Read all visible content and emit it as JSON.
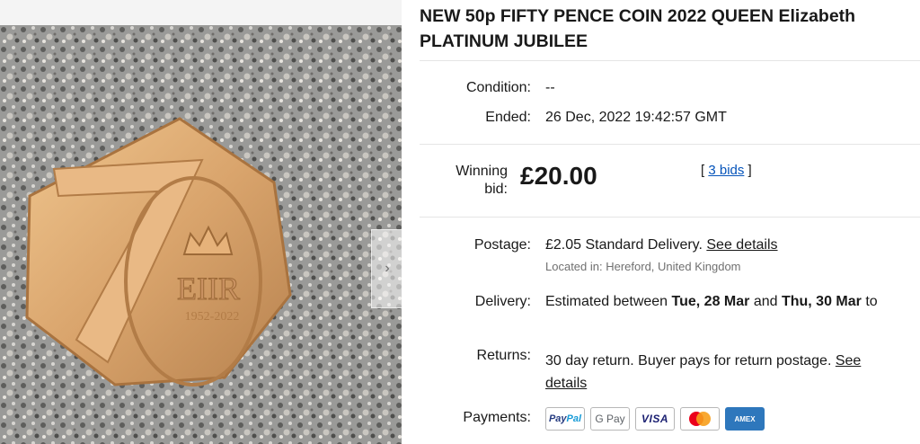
{
  "listing": {
    "title": "NEW 50p FIFTY PENCE COIN 2022 QUEEN Elizabeth PLATINUM JUBILEE"
  },
  "details": {
    "condition_label": "Condition:",
    "condition_value": "--",
    "ended_label": "Ended:",
    "ended_value": "26 Dec, 2022 19:42:57 GMT",
    "winning_label_1": "Winning",
    "winning_label_2": "bid:",
    "price": "£20.00",
    "bids_open": "[ ",
    "bids_link": "3 bids",
    "bids_close": " ]",
    "postage_label": "Postage:",
    "postage_price": "£2.05",
    "postage_service": " Standard Delivery. ",
    "postage_link": "See details",
    "located": "Located in: Hereford, United Kingdom",
    "delivery_label": "Delivery:",
    "delivery_prefix": "Estimated between ",
    "delivery_from": "Tue, 28 Mar",
    "delivery_and": " and ",
    "delivery_to": "Thu, 30 Mar",
    "delivery_suffix": " to",
    "returns_label": "Returns:",
    "returns_text": "30 day return. Buyer pays for return postage. ",
    "returns_link_1": "See",
    "returns_link_2": "details",
    "payments_label": "Payments:"
  },
  "payments": {
    "paypal_a": "Pay",
    "paypal_b": "Pal",
    "gpay": "G Pay",
    "visa": "VISA",
    "amex": "AMEX"
  },
  "image": {
    "coin_text": "1952-2022",
    "coin_cipher": "EIIR"
  },
  "colors": {
    "link": "#0654ba",
    "separator": "#e5e5e5",
    "muted": "#707070"
  }
}
